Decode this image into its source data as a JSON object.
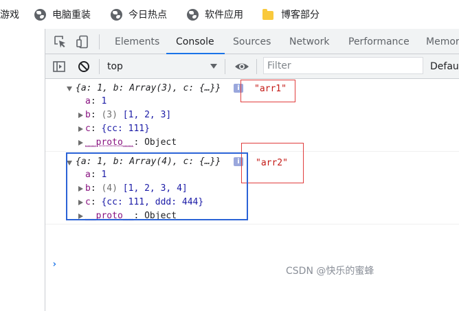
{
  "bookmarks": [
    {
      "label": "游戏",
      "icon": "globe-icon"
    },
    {
      "label": "电脑重装",
      "icon": "globe-icon"
    },
    {
      "label": "今日热点",
      "icon": "globe-icon"
    },
    {
      "label": "软件应用",
      "icon": "globe-icon"
    },
    {
      "label": "博客部分",
      "icon": "folder-icon"
    }
  ],
  "devtools": {
    "tabs": [
      "Elements",
      "Console",
      "Sources",
      "Network",
      "Performance",
      "Memor"
    ],
    "active_tab": "Console",
    "toolbar": {
      "context": "top",
      "filter_placeholder": "Filter",
      "levels": "Defaul"
    }
  },
  "console": {
    "messages": [
      {
        "summary": "{a: 1, b: Array(3), c: {…}}",
        "info_badge": "i",
        "string": "\"arr1\"",
        "props": {
          "a_key": "a",
          "a_val": "1",
          "b_key": "b",
          "b_len": "(3)",
          "b_val": "[1, 2, 3]",
          "c_key": "c",
          "c_val": "{cc: 111}",
          "proto_key": "__proto__",
          "proto_val": "Object"
        }
      },
      {
        "summary": "{a: 1, b: Array(4), c: {…}}",
        "info_badge": "i",
        "string": "\"arr2\"",
        "props": {
          "a_key": "a",
          "a_val": "1",
          "b_key": "b",
          "b_len": "(4)",
          "b_val": "[1, 2, 3, 4]",
          "c_key": "c",
          "c_val": "{cc: 111, ddd: 444}",
          "proto_key": "__proto__",
          "proto_val": "Object"
        }
      }
    ],
    "prompt": "›"
  },
  "watermark": "CSDN @快乐的蜜蜂",
  "colors": {
    "accent": "#1a73e8",
    "annotation_red": "#e03c3c",
    "annotation_blue": "#2a62d6",
    "string": "#c41a16",
    "property": "#881280",
    "number": "#1a1aa6"
  }
}
